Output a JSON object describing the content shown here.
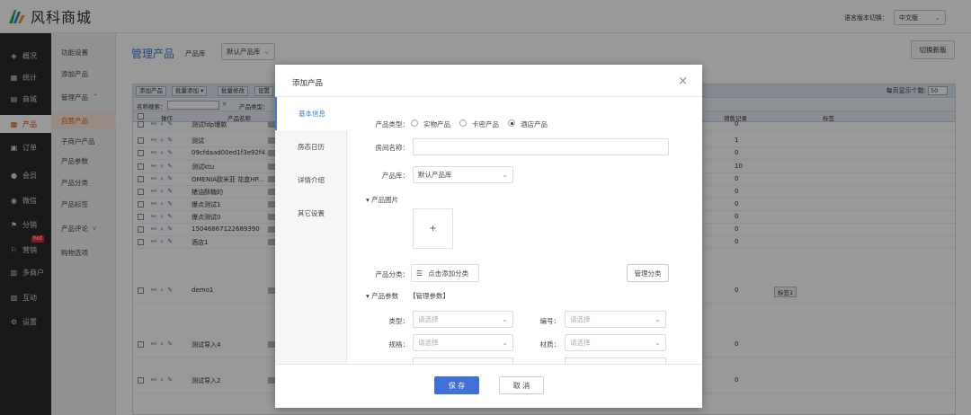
{
  "header": {
    "logo_text": "风科商城",
    "lang_label": "语言版本切换：",
    "lang_value": "中文版"
  },
  "leftnav": {
    "items": [
      {
        "label": "概况",
        "icon": "dashboard-icon"
      },
      {
        "label": "统计",
        "icon": "chart-icon"
      },
      {
        "label": "商城",
        "icon": "store-icon"
      },
      {
        "label": "产品",
        "icon": "product-icon",
        "active": true
      },
      {
        "label": "订单",
        "icon": "order-icon"
      },
      {
        "label": "会员",
        "icon": "member-icon"
      },
      {
        "label": "微信",
        "icon": "wechat-icon"
      },
      {
        "label": "分销",
        "icon": "distribution-icon"
      },
      {
        "label": "营销",
        "icon": "marketing-icon",
        "badge": "hot"
      },
      {
        "label": "多商户",
        "icon": "merchant-icon"
      },
      {
        "label": "互动",
        "icon": "interact-icon"
      },
      {
        "label": "设置",
        "icon": "settings-icon"
      }
    ]
  },
  "subnav": {
    "items": [
      {
        "label": "功能设置"
      },
      {
        "label": "添加产品"
      },
      {
        "label": "管理产品",
        "expand": "^"
      },
      {
        "label": "自营产品",
        "active": true
      },
      {
        "label": "子商户产品"
      },
      {
        "label": "产品参数"
      },
      {
        "label": "产品分类"
      },
      {
        "label": "产品标签"
      },
      {
        "label": "产品评论",
        "expand": "v"
      },
      {
        "label": "购物选项"
      }
    ]
  },
  "main": {
    "title": "管理产品",
    "lib_label": "产品库",
    "lib_value": "默认产品库",
    "switch_btn": "切换新版",
    "toolbar": {
      "add": "添加产品",
      "batch_add": "批量添加 ▾",
      "batch_edit": "批量修改",
      "set": "设置",
      "per_page_label": "每页显示个数:",
      "per_page_value": "50"
    },
    "search": {
      "name_label": "名称搜索：",
      "clear": "✕",
      "type_label": "产品类型："
    },
    "columns": {
      "op": "操作",
      "name": "产品名称",
      "sales": "销售记录",
      "tag": "标签"
    },
    "rows": [
      {
        "name": "测试fdp爆款",
        "sales": "0",
        "tag": ""
      },
      {
        "name": "测试",
        "sales": "1",
        "tag": ""
      },
      {
        "name": "09cfdaad00ed1f3e92f4...",
        "sales": "0",
        "tag": ""
      },
      {
        "name": "测试ktu",
        "sales": "10",
        "tag": ""
      },
      {
        "name": "OMENIA欧米亚 花盒HP...",
        "sales": "0",
        "tag": ""
      },
      {
        "name": "猪油酥糖的",
        "sales": "0",
        "tag": ""
      },
      {
        "name": "爆点测试1",
        "sales": "0",
        "tag": ""
      },
      {
        "name": "爆点测试0",
        "sales": "0",
        "tag": ""
      },
      {
        "name": "15046867122689390",
        "sales": "0",
        "tag": ""
      },
      {
        "name": "酒店1",
        "sales": "0",
        "tag": ""
      },
      {
        "name": "demo1",
        "sales": "0",
        "tag": "标签1"
      },
      {
        "name": "测试导入4",
        "sales": "0",
        "tag": ""
      },
      {
        "name": "测试导入2",
        "sales": "0",
        "tag": ""
      }
    ]
  },
  "modal": {
    "title": "添加产品",
    "close": "×",
    "tabs": [
      "基本信息",
      "房态日历",
      "详情介绍",
      "其它设置"
    ],
    "product_type_label": "产品类型：",
    "type_options": [
      "实物产品",
      "卡密产品",
      "酒店产品"
    ],
    "room_name_label": "房间名称：",
    "room_name_value": "",
    "lib_label": "产品库：",
    "lib_value": "默认产品库",
    "images_section": "▾  产品图片",
    "upload_plus": "+",
    "category_label": "产品分类：",
    "category_btn": "点击添加分类",
    "manage_category": "管理分类",
    "params_section": "▾  产品参数",
    "params_manage": "【管理参数】",
    "param_type_label": "类型：",
    "param_no_label": "编号：",
    "param_spec_label": "规格：",
    "param_material_label": "材质：",
    "select_placeholder": "请选择",
    "save": "保 存",
    "cancel": "取 消"
  }
}
